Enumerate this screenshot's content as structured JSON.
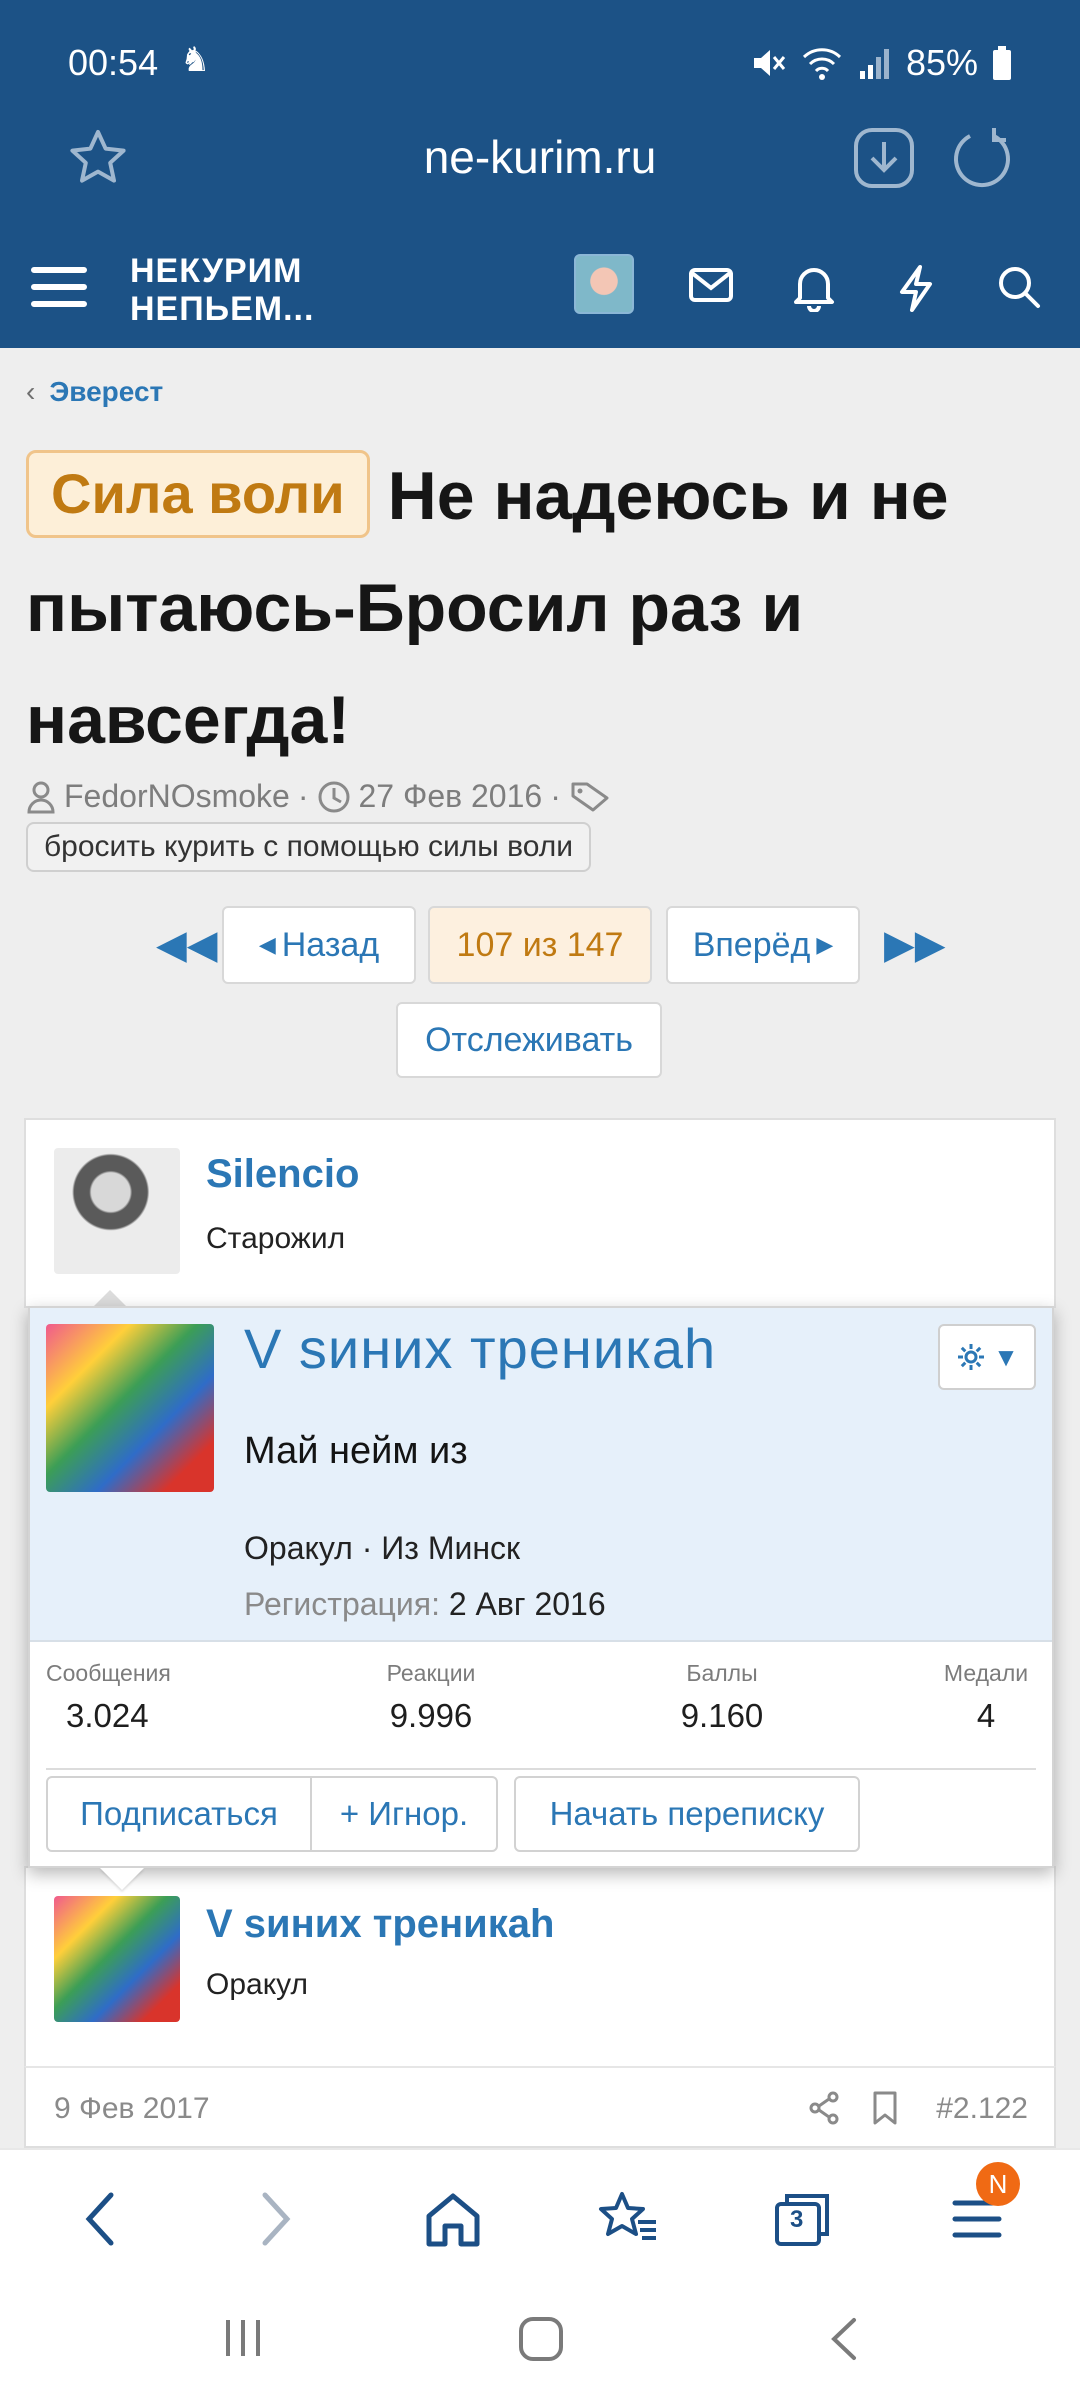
{
  "status_bar": {
    "time": "00:54",
    "battery": "85%"
  },
  "browser": {
    "url": "ne-kurim.ru"
  },
  "site": {
    "logo_line1": "НЕКУРИМ",
    "logo_line2": "НЕПЬЕМ..."
  },
  "breadcrumb": {
    "label": "Эверест"
  },
  "thread": {
    "prefix": "Сила воли",
    "title": "Не надеюсь и не пытаюсь-Бросил раз и навсегда!",
    "author": "FedorNOsmoke",
    "date": "27 Фев 2016",
    "tag": "бросить курить с помощью силы воли"
  },
  "pager": {
    "prev": "Назад",
    "current": "107 из 147",
    "next": "Вперёд",
    "watch": "Отслеживать"
  },
  "post1": {
    "username": "Silencio",
    "user_title": "Старожил"
  },
  "member_card": {
    "name": "V sиних треникаh",
    "status": "Май нейм из",
    "info": "Оракул · Из Минск",
    "reg_label": "Регистрация:",
    "reg_date": "2 Авг 2016",
    "stats": [
      {
        "label": "Сообщения",
        "value": "3.024"
      },
      {
        "label": "Реакции",
        "value": "9.996"
      },
      {
        "label": "Баллы",
        "value": "9.160"
      },
      {
        "label": "Медали",
        "value": "4"
      }
    ],
    "buttons": {
      "follow": "Подписаться",
      "ignore": "+ Игнор.",
      "message": "Начать переписку"
    }
  },
  "post2": {
    "username": "V sиних треникаh",
    "user_title": "Оракул",
    "date": "9 Фев 2017",
    "number": "#2.122"
  },
  "toolbar": {
    "tabs_count": "3",
    "menu_badge": "N"
  },
  "colors": {
    "header": "#1c5286",
    "link": "#2b77b5",
    "prefix_text": "#c07a12",
    "badge": "#f06a14"
  }
}
